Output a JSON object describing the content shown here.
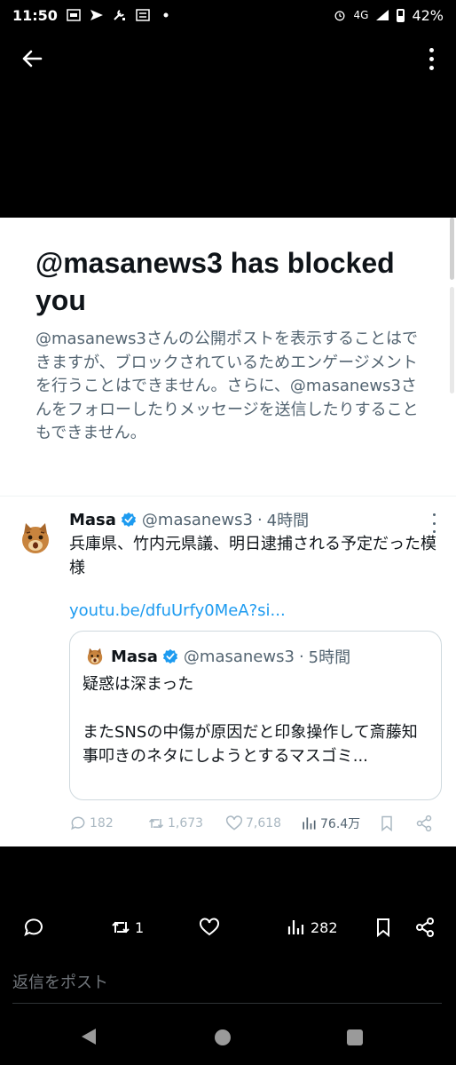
{
  "status_bar": {
    "time": "11:50",
    "network": "4G",
    "battery": "42%"
  },
  "blocked": {
    "title": "@masanews3 has blocked you",
    "message": "@masanews3さんの公開ポストを表示することはできますが、ブロックされているためエンゲージメントを行うことはできません。さらに、@masanews3さんをフォローしたりメッセージを送信したりすることもできません。"
  },
  "post": {
    "name": "Masa",
    "handle": "@masanews3",
    "sep": "·",
    "time": "4時間",
    "text": "兵庫県、竹内元県議、明日逮捕される予定だった模様",
    "link": "youtu.be/dfuUrfy0MeA?si..."
  },
  "quote": {
    "name": "Masa",
    "handle": "@masanews3",
    "sep": "·",
    "time": "5時間",
    "line1": "疑惑は深まった",
    "line2": "またSNSの中傷が原因だと印象操作して斎藤知事叩きのネタにしようとするマスゴミ..."
  },
  "post_actions": {
    "replies": "182",
    "reposts": "1,673",
    "likes": "7,618",
    "views": "76.4万"
  },
  "bottom_actions": {
    "reposts": "1",
    "views": "282"
  },
  "reply_input": {
    "placeholder": "返信をポスト"
  },
  "colors": {
    "accent": "#1d9bf0",
    "secondary_text": "#536471",
    "verified": "#1d9bf0"
  }
}
